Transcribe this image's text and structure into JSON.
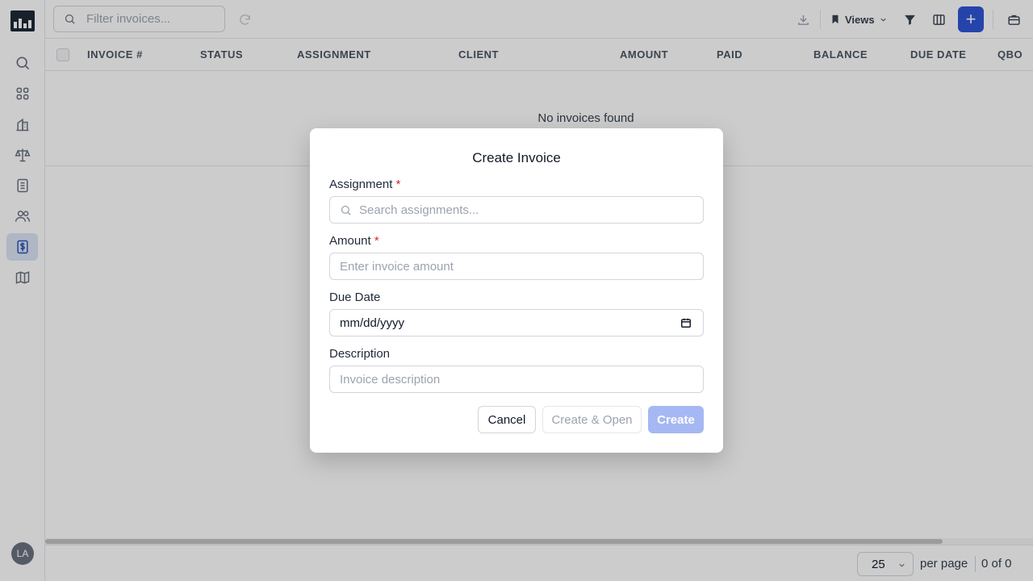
{
  "toolbar": {
    "filter_placeholder": "Filter invoices...",
    "views_label": "Views",
    "add_label": "+"
  },
  "table": {
    "columns": [
      "INVOICE #",
      "STATUS",
      "ASSIGNMENT",
      "CLIENT",
      "AMOUNT",
      "PAID",
      "BALANCE",
      "DUE DATE",
      "QBO"
    ],
    "empty_message": "No invoices found"
  },
  "footer": {
    "per_page_value": "25",
    "per_page_label": "per page",
    "range": "0 of 0"
  },
  "user": {
    "initials": "LA"
  },
  "modal": {
    "title": "Create Invoice",
    "assignment_label": "Assignment",
    "assignment_placeholder": "Search assignments...",
    "amount_label": "Amount",
    "amount_placeholder": "Enter invoice amount",
    "due_date_label": "Due Date",
    "due_date_value": "mm/dd/yyyy",
    "description_label": "Description",
    "description_placeholder": "Invoice description",
    "required_marker": "*",
    "cancel_label": "Cancel",
    "create_open_label": "Create & Open",
    "create_label": "Create"
  },
  "colors": {
    "accent": "#2f56d6",
    "accent_disabled": "#a5b8f3",
    "required": "#dc2626",
    "sidebar_active_bg": "#dbe4f6"
  },
  "icons": {
    "sidebar": [
      "search-icon",
      "grid-icon",
      "building-icon",
      "scale-icon",
      "notebook-icon",
      "users-icon",
      "invoice-dollar-icon",
      "map-icon"
    ],
    "toolbar": [
      "refresh-icon",
      "download-icon",
      "bookmark-icon",
      "filter-icon",
      "columns-icon",
      "plus-icon",
      "briefcase-icon"
    ]
  }
}
